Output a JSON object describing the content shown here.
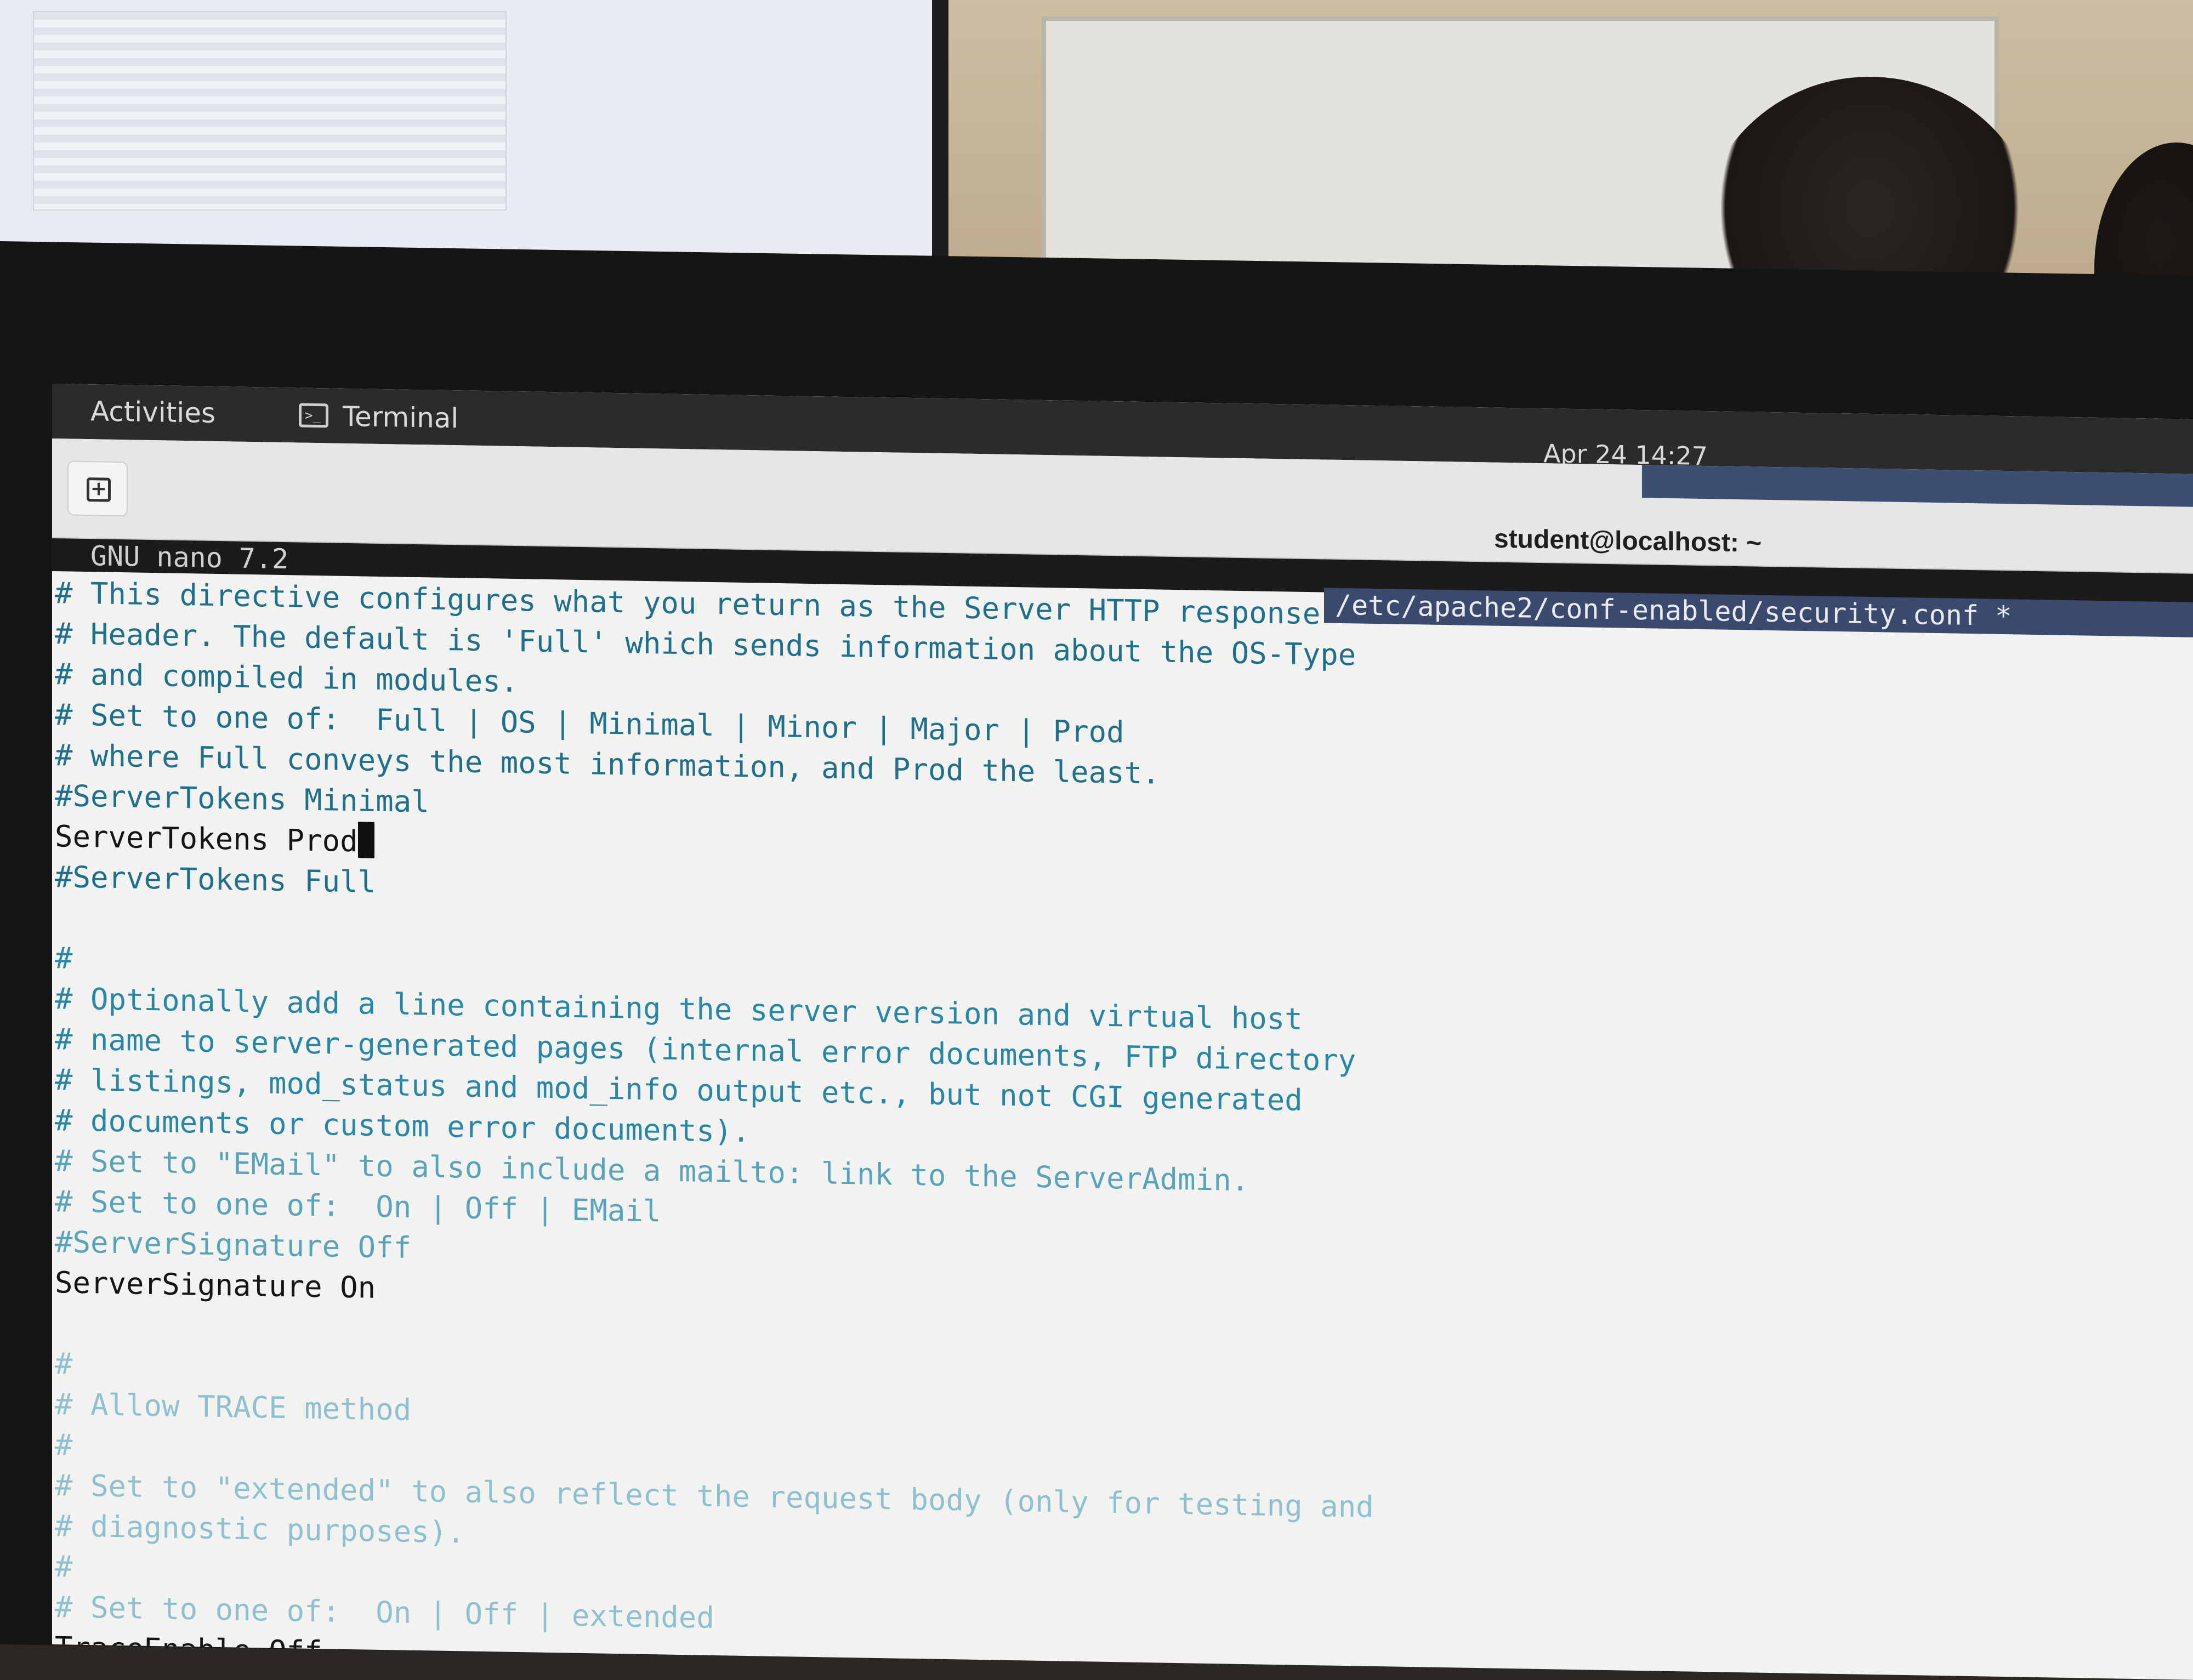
{
  "topbar": {
    "activities_label": "Activities",
    "app_name": "Terminal",
    "clock": "Apr 24  14:27"
  },
  "terminal": {
    "window_title": "student@localhost: ~",
    "new_tab_symbol": "+"
  },
  "nano": {
    "version_label": "GNU  nano  7.2",
    "file_path": "/etc/apache2/conf-enabled/security.conf *"
  },
  "editor_lines": [
    {
      "text": "# This directive configures what you return as the Server HTTP response",
      "style": "c1"
    },
    {
      "text": "# Header. The default is 'Full' which sends information about the OS-Type",
      "style": "c1"
    },
    {
      "text": "# and compiled in modules.",
      "style": "c1"
    },
    {
      "text": "# Set to one of:  Full | OS | Minimal | Minor | Major | Prod",
      "style": "c1"
    },
    {
      "text": "# where Full conveys the most information, and Prod the least.",
      "style": "c1"
    },
    {
      "text": "#ServerTokens Minimal",
      "style": "c1"
    },
    {
      "text": "ServerTokens Prod",
      "style": "plain",
      "cursor": true
    },
    {
      "text": "#ServerTokens Full",
      "style": "c1"
    },
    {
      "text": "",
      "style": "c1"
    },
    {
      "text": "#",
      "style": "c2"
    },
    {
      "text": "# Optionally add a line containing the server version and virtual host",
      "style": "c2"
    },
    {
      "text": "# name to server-generated pages (internal error documents, FTP directory",
      "style": "c2"
    },
    {
      "text": "# listings, mod_status and mod_info output etc., but not CGI generated",
      "style": "c2"
    },
    {
      "text": "# documents or custom error documents).",
      "style": "c2"
    },
    {
      "text": "# Set to \"EMail\" to also include a mailto: link to the ServerAdmin.",
      "style": "c3"
    },
    {
      "text": "# Set to one of:  On | Off | EMail",
      "style": "c3"
    },
    {
      "text": "#ServerSignature Off",
      "style": "c3"
    },
    {
      "text": "ServerSignature On",
      "style": "plain"
    },
    {
      "text": "",
      "style": "c3"
    },
    {
      "text": "#",
      "style": "c4"
    },
    {
      "text": "# Allow TRACE method",
      "style": "c4"
    },
    {
      "text": "#",
      "style": "c4"
    },
    {
      "text": "# Set to \"extended\" to also reflect the request body (only for testing and",
      "style": "c4"
    },
    {
      "text": "# diagnostic purposes).",
      "style": "c4"
    },
    {
      "text": "#",
      "style": "c4"
    },
    {
      "text": "# Set to one of:  On | Off | extended",
      "style": "c4"
    },
    {
      "text": "TraceEnable Off",
      "style": "plain"
    }
  ]
}
